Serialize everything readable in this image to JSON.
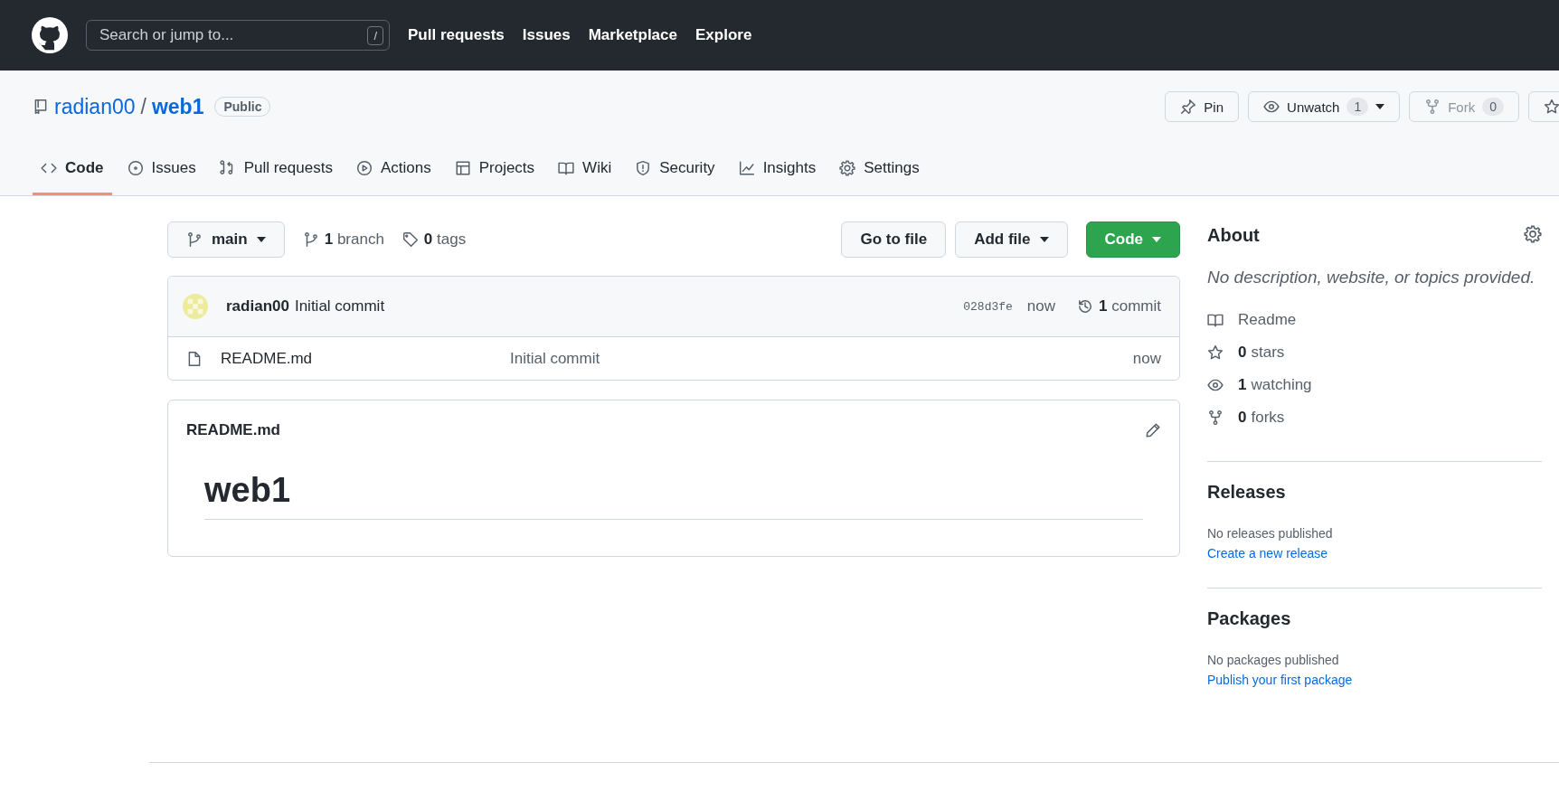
{
  "top_nav": {
    "search": {
      "placeholder": "Search or jump to...",
      "shortcut": "/"
    },
    "links": [
      "Pull requests",
      "Issues",
      "Marketplace",
      "Explore"
    ]
  },
  "repo": {
    "owner": "radian00",
    "separator": "/",
    "name": "web1",
    "visibility": "Public"
  },
  "repo_actions": [
    {
      "kind": "pin",
      "label": "Pin",
      "disabled": false
    },
    {
      "kind": "watch",
      "label": "Unwatch",
      "count": "1",
      "disabled": false
    },
    {
      "kind": "fork",
      "label": "Fork",
      "count": "0",
      "disabled": true
    },
    {
      "kind": "star",
      "disabled": false
    }
  ],
  "tabs": [
    {
      "kind": "code",
      "label": "Code",
      "selected": true
    },
    {
      "kind": "issue",
      "label": "Issues",
      "selected": false
    },
    {
      "kind": "pr",
      "label": "Pull requests",
      "selected": false
    },
    {
      "kind": "play",
      "label": "Actions",
      "selected": false
    },
    {
      "kind": "table",
      "label": "Projects",
      "selected": false
    },
    {
      "kind": "book",
      "label": "Wiki",
      "selected": false
    },
    {
      "kind": "shield",
      "label": "Security",
      "selected": false
    },
    {
      "kind": "graph",
      "label": "Insights",
      "selected": false
    },
    {
      "kind": "gear",
      "label": "Settings",
      "selected": false
    }
  ],
  "branch_bar": {
    "branch": "main",
    "branches": {
      "count": "1",
      "label": "branch"
    },
    "tags": {
      "count": "0",
      "label": "tags"
    },
    "buttons": [
      {
        "kind": "plain",
        "label": "Go to file"
      },
      {
        "kind": "dropdown",
        "label": "Add file"
      },
      {
        "kind": "primary",
        "label": "Code"
      }
    ]
  },
  "latest_commit": {
    "author": "radian00",
    "message": "Initial commit",
    "sha": "028d3fe",
    "time": "now",
    "commits": {
      "count": "1",
      "label": "commit"
    }
  },
  "files": [
    {
      "name": "README.md",
      "message": "Initial commit",
      "time": "now"
    }
  ],
  "readme": {
    "filename": "README.md",
    "heading": "web1"
  },
  "about": {
    "title": "About",
    "description": "No description, website, or topics provided.",
    "items": [
      {
        "kind": "book",
        "label": "Readme"
      },
      {
        "kind": "star",
        "count": "0",
        "label": "stars"
      },
      {
        "kind": "eye",
        "count": "1",
        "label": "watching"
      },
      {
        "kind": "fork",
        "count": "0",
        "label": "forks"
      }
    ]
  },
  "releases": {
    "title": "Releases",
    "note": "No releases published",
    "link": "Create a new release"
  },
  "packages": {
    "title": "Packages",
    "note": "No packages published",
    "link": "Publish your first package"
  }
}
